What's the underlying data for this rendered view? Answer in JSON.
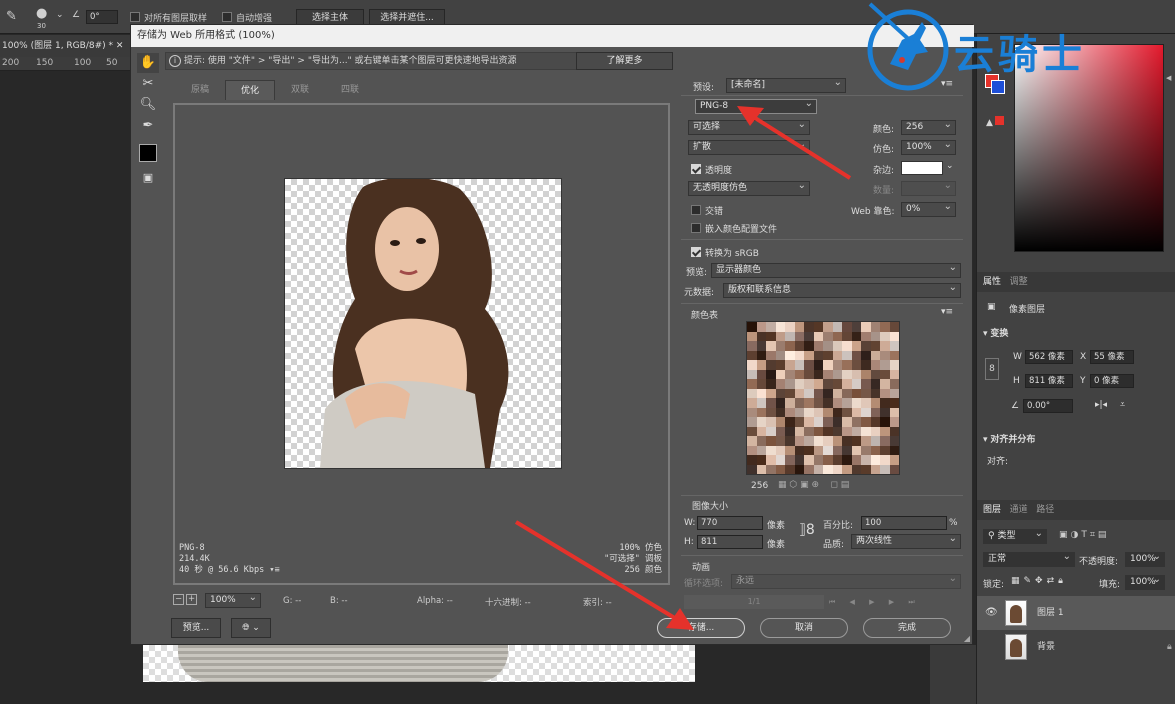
{
  "optionsbar": {
    "brush_size": "30",
    "angle": "0°",
    "sample_all": "对所有图层取样",
    "auto_enhance": "自动增强",
    "select_subject": "选择主体",
    "select_mask": "选择并遮住..."
  },
  "doc": {
    "tab_title": "100% (图层 1, RGB/8#) *",
    "ruler": [
      "200",
      "150",
      "100",
      "50"
    ]
  },
  "dialog": {
    "title": "存储为 Web 所用格式 (100%)",
    "tip": "提示: 使用 \"文件\" > \"导出\" > \"导出为...\" 或右键单击某个图层可更快速地导出资源",
    "learn_more": "了解更多",
    "tabs": [
      "原稿",
      "优化",
      "双联",
      "四联"
    ],
    "preview_info_left": [
      "PNG-8",
      "214.4K",
      "40 秒 @ 56.6 Kbps"
    ],
    "preview_info_right": [
      "100% 仿色",
      "\"可选择\" 调板",
      "256 颜色"
    ],
    "status": {
      "zoom": "100%",
      "g": "G: --",
      "b": "B: --",
      "alpha": "Alpha: --",
      "hex": "十六进制: --",
      "index": "索引: --"
    },
    "preview_btn": "预览...",
    "save_btn": "存储...",
    "cancel_btn": "取消",
    "done_btn": "完成",
    "settings": {
      "preset_label": "预设:",
      "preset_value": "[未命名]",
      "format": "PNG-8",
      "reduction": "可选择",
      "colors_label": "颜色:",
      "colors_value": "256",
      "dither_algo": "扩散",
      "dither_label": "仿色:",
      "dither_value": "100%",
      "transparency": "透明度",
      "matte_label": "杂边:",
      "transp_dither": "无透明度仿色",
      "amount_label": "数量:",
      "interlaced": "交错",
      "websnap_label": "Web 靠色:",
      "websnap_value": "0%",
      "embed_profile": "嵌入颜色配置文件",
      "convert_srgb": "转换为 sRGB",
      "preview_label": "预览:",
      "preview_value": "显示器颜色",
      "metadata_label": "元数据:",
      "metadata_value": "版权和联系信息",
      "color_table_title": "颜色表",
      "color_count": "256",
      "image_size_title": "图像大小",
      "w_label": "W:",
      "w_value": "770",
      "h_label": "H:",
      "h_value": "811",
      "px": "像素",
      "percent_label": "百分比:",
      "percent_value": "100",
      "percent_sign": "%",
      "quality_label": "品质:",
      "quality_value": "两次线性",
      "animation_title": "动画",
      "loop_label": "循环选项:",
      "loop_value": "永远",
      "frame_counter": "1/1"
    }
  },
  "right": {
    "props_tabs": [
      "属性",
      "调整"
    ],
    "pixel_layer": "像素图层",
    "transform": "变换",
    "w": "W",
    "w_val": "562 像素",
    "x": "X",
    "x_val": "55 像素",
    "h": "H",
    "h_val": "811 像素",
    "y": "Y",
    "y_val": "0 像素",
    "angle": "0.00°",
    "align": "对齐并分布",
    "align_sub": "对齐:",
    "layers_tabs": [
      "图层",
      "通道",
      "路径"
    ],
    "kind": "类型",
    "blend": "正常",
    "opacity_label": "不透明度:",
    "opacity": "100%",
    "lock_label": "锁定:",
    "fill_label": "填充:",
    "fill": "100%",
    "layers": [
      "图层 1",
      "背景"
    ]
  },
  "watermark": "云骑士",
  "colors": {
    "accent_red": "#e5322b",
    "watermark_blue": "#1a7fd6"
  }
}
